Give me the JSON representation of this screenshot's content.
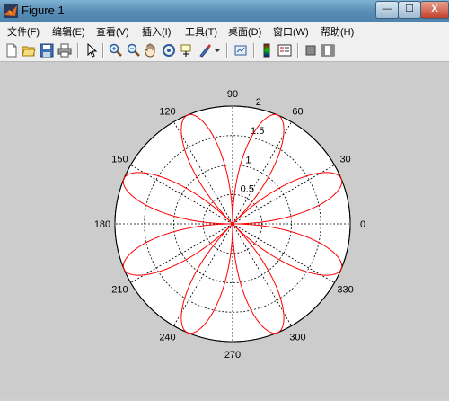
{
  "window": {
    "title": "Figure 1",
    "min_label": "—",
    "max_label": "☐",
    "close_label": "X"
  },
  "menu": {
    "items": [
      "文件(F)",
      "编辑(E)",
      "查看(V)",
      "插入(I)",
      "工具(T)",
      "桌面(D)",
      "窗口(W)",
      "帮助(H)"
    ]
  },
  "toolbar": {
    "icons": [
      "new-figure-icon",
      "open-file-icon",
      "save-icon",
      "print-icon",
      "pointer-icon",
      "zoom-in-icon",
      "zoom-out-icon",
      "pan-hand-icon",
      "rotate-3d-icon",
      "data-cursor-icon",
      "brush-icon",
      "brush-dropdown-icon",
      "link-plot-icon",
      "colorbar-icon",
      "legend-icon",
      "hide-plot-tools-icon",
      "show-plot-tools-icon"
    ]
  },
  "chart_data": {
    "type": "polar",
    "function": "r = 2*sin(4*theta)",
    "line_color": "#ff0000",
    "r_max": 2,
    "radial_ticks": [
      "0.5",
      "1",
      "1.5",
      "2"
    ],
    "angle_ticks": [
      "0",
      "30",
      "60",
      "90",
      "120",
      "150",
      "180",
      "210",
      "240",
      "270",
      "300",
      "330"
    ],
    "angle_tick_values": [
      0,
      30,
      60,
      90,
      120,
      150,
      180,
      210,
      240,
      270,
      300,
      330
    ],
    "grid": true,
    "background": "#ffffff",
    "figure_background": "#cccccc"
  }
}
